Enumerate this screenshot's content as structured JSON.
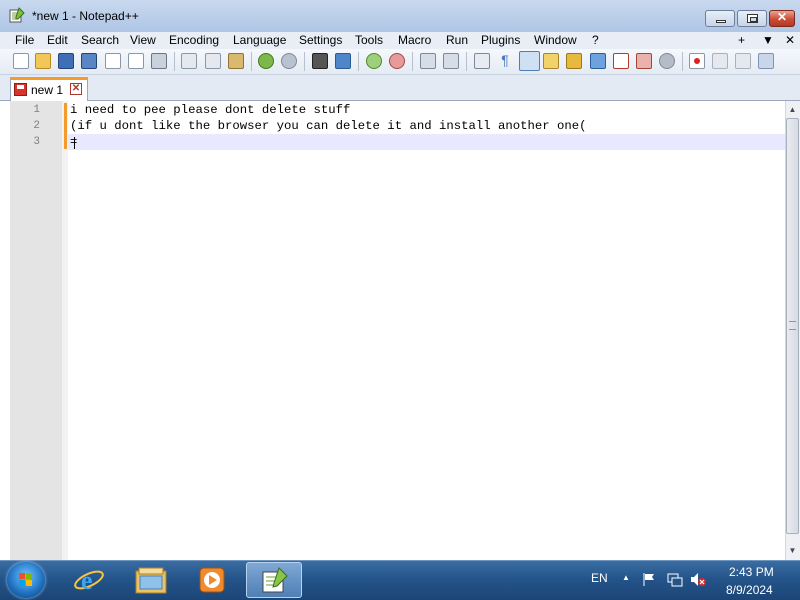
{
  "window": {
    "title": "*new 1 - Notepad++"
  },
  "menu": [
    "File",
    "Edit",
    "Search",
    "View",
    "Encoding",
    "Language",
    "Settings",
    "Tools",
    "Macro",
    "Run",
    "Plugins",
    "Window",
    "?"
  ],
  "menu_right": {
    "plus": "+",
    "down": "▼",
    "close": "✕"
  },
  "tab": {
    "label": "new 1",
    "close": "✕"
  },
  "editor": {
    "line_numbers": [
      "1",
      "2",
      "3"
    ],
    "lines": [
      "i need to pee please dont delete stuff",
      "(if u dont like the browser you can delete it and install another one(",
      "="
    ]
  },
  "taskbar": {
    "language": "EN",
    "time": "2:43 PM",
    "date": "8/9/2024"
  },
  "colors": {
    "modified_marker": "#f39c2b",
    "current_line": "#e8e8ff"
  }
}
